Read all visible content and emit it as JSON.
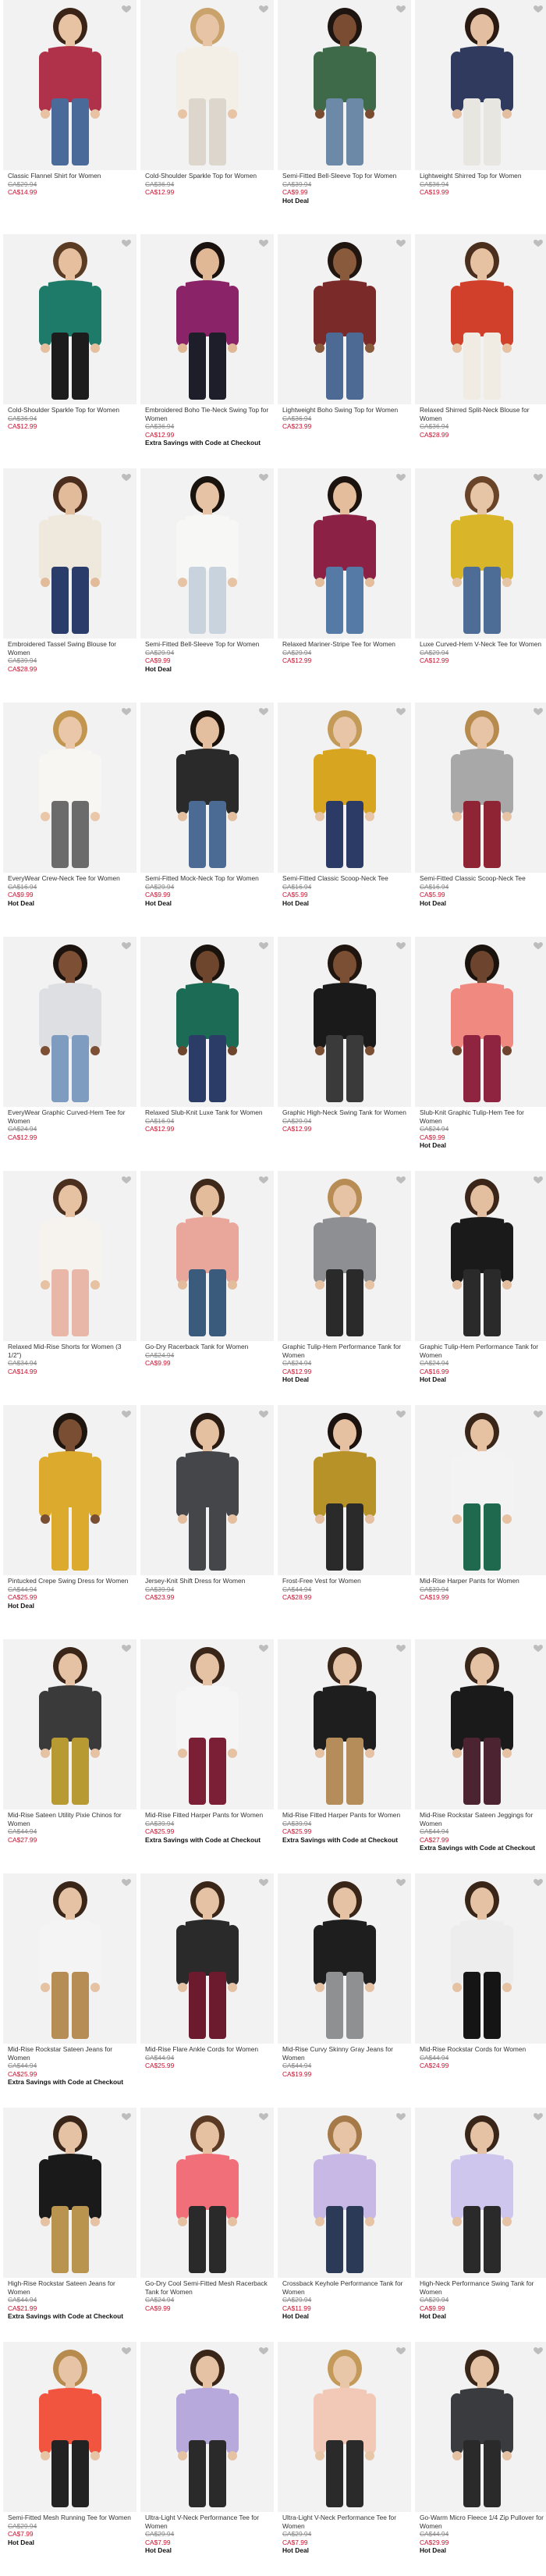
{
  "colors": {
    "tile_bg": "#f2f2f2",
    "sale_price": "#c8102e",
    "was_price": "#888888"
  },
  "icons": {
    "favorite": "heart-icon"
  },
  "products": [
    {
      "name": "Classic Flannel Shirt for Women",
      "was": "CA$29.94",
      "now": "CA$14.99",
      "badge": "",
      "top": "#b0324a",
      "bottom": "#4a6a9a",
      "hair": "#3a2418",
      "skin": "#e7c2a3"
    },
    {
      "name": "Cold-Shoulder Sparkle Top for Women",
      "was": "CA$36.94",
      "now": "CA$12.99",
      "badge": "",
      "top": "#f3efe6",
      "bottom": "#dcd6cc",
      "hair": "#c9a36b",
      "skin": "#e8c4a6"
    },
    {
      "name": "Semi-Fitted Bell-Sleeve Top for Women",
      "was": "CA$39.94",
      "now": "CA$9.99",
      "badge": "Hot Deal",
      "top": "#3e6a4a",
      "bottom": "#6c8aa8",
      "hair": "#1e1410",
      "skin": "#7a4d33"
    },
    {
      "name": "Lightweight Shirred Top for Women",
      "was": "CA$36.94",
      "now": "CA$19.99",
      "badge": "",
      "top": "#2f3a5e",
      "bottom": "#e8e6e0",
      "hair": "#2a1a12",
      "skin": "#e3bea0"
    },
    {
      "name": "Cold-Shoulder Sparkle Top for Women",
      "was": "CA$36.94",
      "now": "CA$12.99",
      "badge": "",
      "top": "#1e7b6a",
      "bottom": "#1c1c1c",
      "hair": "#5a3b24",
      "skin": "#e5bf9e"
    },
    {
      "name": "Embroidered Boho Tie-Neck Swing Top for Women",
      "was": "CA$36.94",
      "now": "CA$12.99",
      "badge": "Extra Savings with Code at Checkout",
      "top": "#8a2367",
      "bottom": "#1e1e2a",
      "hair": "#1a120e",
      "skin": "#e1b895"
    },
    {
      "name": "Lightweight Boho Swing Top for Women",
      "was": "CA$36.94",
      "now": "CA$23.99",
      "badge": "",
      "top": "#7b2a2a",
      "bottom": "#4c6a93",
      "hair": "#20150f",
      "skin": "#8a5a3c"
    },
    {
      "name": "Relaxed Shirred Split-Neck Blouse for Women",
      "was": "CA$36.94",
      "now": "CA$28.99",
      "badge": "",
      "top": "#d1402a",
      "bottom": "#f0ece4",
      "hair": "#4a2f1e",
      "skin": "#e6c1a2"
    },
    {
      "name": "Embroidered Tassel Swing Blouse for Women",
      "was": "CA$39.94",
      "now": "CA$28.99",
      "badge": "",
      "top": "#efe8dc",
      "bottom": "#2a3d6a",
      "hair": "#4a2d1c",
      "skin": "#e2bb9b"
    },
    {
      "name": "Semi-Fitted Bell-Sleeve Top for Women",
      "was": "CA$29.94",
      "now": "CA$9.99",
      "badge": "Hot Deal",
      "top": "#f7f7f5",
      "bottom": "#c9d3dd",
      "hair": "#1a120c",
      "skin": "#e7c3a5"
    },
    {
      "name": "Relaxed Mariner-Stripe Tee for Women",
      "was": "CA$29.94",
      "now": "CA$12.99",
      "badge": "",
      "top": "#8b2246",
      "bottom": "#557aa6",
      "hair": "#1c130e",
      "skin": "#e3bd9c"
    },
    {
      "name": "Luxe Curved-Hem V-Neck Tee for Women",
      "was": "CA$29.94",
      "now": "CA$12.99",
      "badge": "",
      "top": "#d9b52a",
      "bottom": "#4d6d96",
      "hair": "#6a4428",
      "skin": "#e6c4a6"
    },
    {
      "name": "EveryWear Crew-Neck Tee for Women",
      "was": "CA$16.94",
      "now": "CA$9.99",
      "badge": "Hot Deal",
      "top": "#f7f6f2",
      "bottom": "#6b6b6b",
      "hair": "#c2964f",
      "skin": "#e9c7a8"
    },
    {
      "name": "Semi-Fitted Mock-Neck Top for Women",
      "was": "CA$29.94",
      "now": "CA$9.99",
      "badge": "Hot Deal",
      "top": "#2a2a2a",
      "bottom": "#4b6b94",
      "hair": "#1a110b",
      "skin": "#e3bfa0"
    },
    {
      "name": "Semi-Fitted Classic Scoop-Neck Tee",
      "was": "CA$16.94",
      "now": "CA$5.99",
      "badge": "Hot Deal",
      "top": "#d8a520",
      "bottom": "#2b3b66",
      "hair": "#c39a58",
      "skin": "#e8c5a6"
    },
    {
      "name": "Semi-Fitted Classic Scoop-Neck Tee",
      "was": "CA$16.94",
      "now": "CA$5.99",
      "badge": "Hot Deal",
      "top": "#a8a8a8",
      "bottom": "#8f2435",
      "hair": "#b78a4e",
      "skin": "#e7c4a5"
    },
    {
      "name": "EveryWear Graphic Curved-Hem Tee for Women",
      "was": "CA$24.94",
      "now": "CA$12.99",
      "badge": "",
      "top": "#dedfe3",
      "bottom": "#7e9bc0",
      "hair": "#1c130e",
      "skin": "#7d5035"
    },
    {
      "name": "Relaxed Slub-Knit Luxe Tank for Women",
      "was": "CA$16.94",
      "now": "CA$12.99",
      "badge": "",
      "top": "#1b6b55",
      "bottom": "#2b3c66",
      "hair": "#1a120d",
      "skin": "#6e452d"
    },
    {
      "name": "Graphic High-Neck Swing Tank for Women",
      "was": "CA$29.94",
      "now": "CA$12.99",
      "badge": "",
      "top": "#1a1a1a",
      "bottom": "#3a3a3a",
      "hair": "#20150f",
      "skin": "#7b4f34"
    },
    {
      "name": "Slub-Knit Graphic Tulip-Hem Tee for Women",
      "was": "CA$24.94",
      "now": "CA$9.99",
      "badge": "Hot Deal",
      "top": "#f08a80",
      "bottom": "#8e2440",
      "hair": "#1a120d",
      "skin": "#6d452e"
    },
    {
      "name": "Relaxed Mid-Rise Shorts for Women (3 1/2\")",
      "was": "CA$34.94",
      "now": "CA$14.99",
      "badge": "",
      "top": "#f6f3ee",
      "bottom": "#e9b7a8",
      "hair": "#4a2e1e",
      "skin": "#e7c2a2"
    },
    {
      "name": "Go-Dry Racerback Tank for Women",
      "was": "CA$24.94",
      "now": "CA$9.99",
      "badge": "",
      "top": "#e8a79a",
      "bottom": "#3b5b7d",
      "hair": "#3e281a",
      "skin": "#e2bc9b"
    },
    {
      "name": "Graphic Tulip-Hem Performance Tank for Women",
      "was": "CA$24.94",
      "now": "CA$12.99",
      "badge": "Hot Deal",
      "top": "#8e8f92",
      "bottom": "#2a2a2a",
      "hair": "#b78d55",
      "skin": "#e6c3a4"
    },
    {
      "name": "Graphic Tulip-Hem Performance Tank for Women",
      "was": "CA$24.94",
      "now": "CA$16.99",
      "badge": "Hot Deal",
      "top": "#1a1a1a",
      "bottom": "#2a2a2a",
      "hair": "#3a2518",
      "skin": "#e4bf9f"
    },
    {
      "name": "Pintucked Crepe Swing Dress for Women",
      "was": "CA$44.94",
      "now": "CA$25.99",
      "badge": "Hot Deal",
      "top": "#dcaa2c",
      "bottom": "#dcaa2c",
      "hair": "#1e150f",
      "skin": "#7a4e33"
    },
    {
      "name": "Jersey-Knit Shift Dress for Women",
      "was": "CA$39.94",
      "now": "CA$23.99",
      "badge": "",
      "top": "#45464a",
      "bottom": "#45464a",
      "hair": "#2a1b12",
      "skin": "#e4c0a1"
    },
    {
      "name": "Frost-Free Vest for Women",
      "was": "CA$44.94",
      "now": "CA$28.99",
      "badge": "",
      "top": "#b79228",
      "bottom": "#2a2a2a",
      "hair": "#1c130e",
      "skin": "#e5c1a2"
    },
    {
      "name": "Mid-Rise Harper Pants for Women",
      "was": "CA$39.94",
      "now": "CA$19.99",
      "badge": "",
      "top": "#f3f3f3",
      "bottom": "#1f6a4f",
      "hair": "#3a2519",
      "skin": "#e6c2a3"
    },
    {
      "name": "Mid-Rise Sateen Utility Pixie Chinos for Women",
      "was": "CA$44.94",
      "now": "CA$27.99",
      "badge": "",
      "top": "#3a3a3a",
      "bottom": "#b89a32",
      "hair": "#3a2519",
      "skin": "#e5c2a3"
    },
    {
      "name": "Mid-Rise Fitted Harper Pants for Women",
      "was": "CA$39.94",
      "now": "CA$25.99",
      "badge": "Extra Savings with Code at Checkout",
      "top": "#f5f5f5",
      "bottom": "#7b1f36",
      "hair": "#3a2519",
      "skin": "#e5c2a3"
    },
    {
      "name": "Mid-Rise Fitted Harper Pants for Women",
      "was": "CA$39.94",
      "now": "CA$25.99",
      "badge": "Extra Savings with Code at Checkout",
      "top": "#1e1e1e",
      "bottom": "#b48d5a",
      "hair": "#3a2519",
      "skin": "#e5c2a3"
    },
    {
      "name": "Mid-Rise Rockstar Sateen Jeggings for Women",
      "was": "CA$44.94",
      "now": "CA$27.99",
      "badge": "Extra Savings with Code at Checkout",
      "top": "#1a1a1a",
      "bottom": "#4c2330",
      "hair": "#3a2519",
      "skin": "#e5c2a3"
    },
    {
      "name": "Mid-Rise Rockstar Sateen Jeans for Women",
      "was": "CA$44.94",
      "now": "CA$25.99",
      "badge": "Extra Savings with Code at Checkout",
      "top": "#f4f4f4",
      "bottom": "#b58d55",
      "hair": "#3a2519",
      "skin": "#e5c2a3"
    },
    {
      "name": "Mid-Rise Flare Ankle Cords for Women",
      "was": "CA$44.94",
      "now": "CA$25.99",
      "badge": "",
      "top": "#2a2a2a",
      "bottom": "#6b1b2d",
      "hair": "#3a2519",
      "skin": "#e5c2a3"
    },
    {
      "name": "Mid-Rise Curvy Skinny Gray Jeans for Women",
      "was": "CA$44.94",
      "now": "CA$19.99",
      "badge": "",
      "top": "#1e1e1e",
      "bottom": "#8f9092",
      "hair": "#3a2519",
      "skin": "#e5c2a3"
    },
    {
      "name": "Mid-Rise Rockstar Cords for Women",
      "was": "CA$44.94",
      "now": "CA$24.99",
      "badge": "",
      "top": "#ededed",
      "bottom": "#151515",
      "hair": "#3a2519",
      "skin": "#e5c2a3"
    },
    {
      "name": "High-Rise Rockstar Sateen Jeans for Women",
      "was": "CA$44.94",
      "now": "CA$21.99",
      "badge": "Extra Savings with Code at Checkout",
      "top": "#1a1a1a",
      "bottom": "#b8944e",
      "hair": "#3a2519",
      "skin": "#e5c2a3"
    },
    {
      "name": "Go-Dry Cool Semi-Fitted Mesh Racerback Tank for Women",
      "was": "CA$24.94",
      "now": "CA$9.99",
      "badge": "",
      "top": "#f06f78",
      "bottom": "#2a2a2a",
      "hair": "#5a3a24",
      "skin": "#e5c1a2"
    },
    {
      "name": "Crossback Keyhole Performance Tank for Women",
      "was": "CA$29.94",
      "now": "CA$11.99",
      "badge": "Hot Deal",
      "top": "#c8b8e6",
      "bottom": "#2b3a56",
      "hair": "#a57a48",
      "skin": "#e7c4a6"
    },
    {
      "name": "High-Neck Performance Swing Tank for Women",
      "was": "CA$29.94",
      "now": "CA$9.99",
      "badge": "Hot Deal",
      "top": "#cfc6ee",
      "bottom": "#2a2a2a",
      "hair": "#3a2519",
      "skin": "#e5c2a3"
    },
    {
      "name": "Semi-Fitted Mesh Running Tee for Women",
      "was": "CA$29.94",
      "now": "CA$7.99",
      "badge": "Hot Deal",
      "top": "#f2553f",
      "bottom": "#222222",
      "hair": "#b78a4e",
      "skin": "#e7c4a5"
    },
    {
      "name": "Ultra-Light V-Neck Performance Tee for Women",
      "was": "CA$29.94",
      "now": "CA$7.99",
      "badge": "Hot Deal",
      "top": "#b7a9dc",
      "bottom": "#2a2a2a",
      "hair": "#3a2519",
      "skin": "#e5c2a3"
    },
    {
      "name": "Ultra-Light V-Neck Performance Tee for Women",
      "was": "CA$29.94",
      "now": "CA$7.99",
      "badge": "Hot Deal",
      "top": "#f2c8b6",
      "bottom": "#2a2a2a",
      "hair": "#c49a5a",
      "skin": "#e8c6a8"
    },
    {
      "name": "Go-Warm Micro Fleece 1/4 Zip Pullover for Women",
      "was": "CA$44.94",
      "now": "CA$29.99",
      "badge": "Hot Deal",
      "top": "#3a3b3f",
      "bottom": "#2a2a2a",
      "hair": "#3a2519",
      "skin": "#e5c2a3"
    }
  ]
}
